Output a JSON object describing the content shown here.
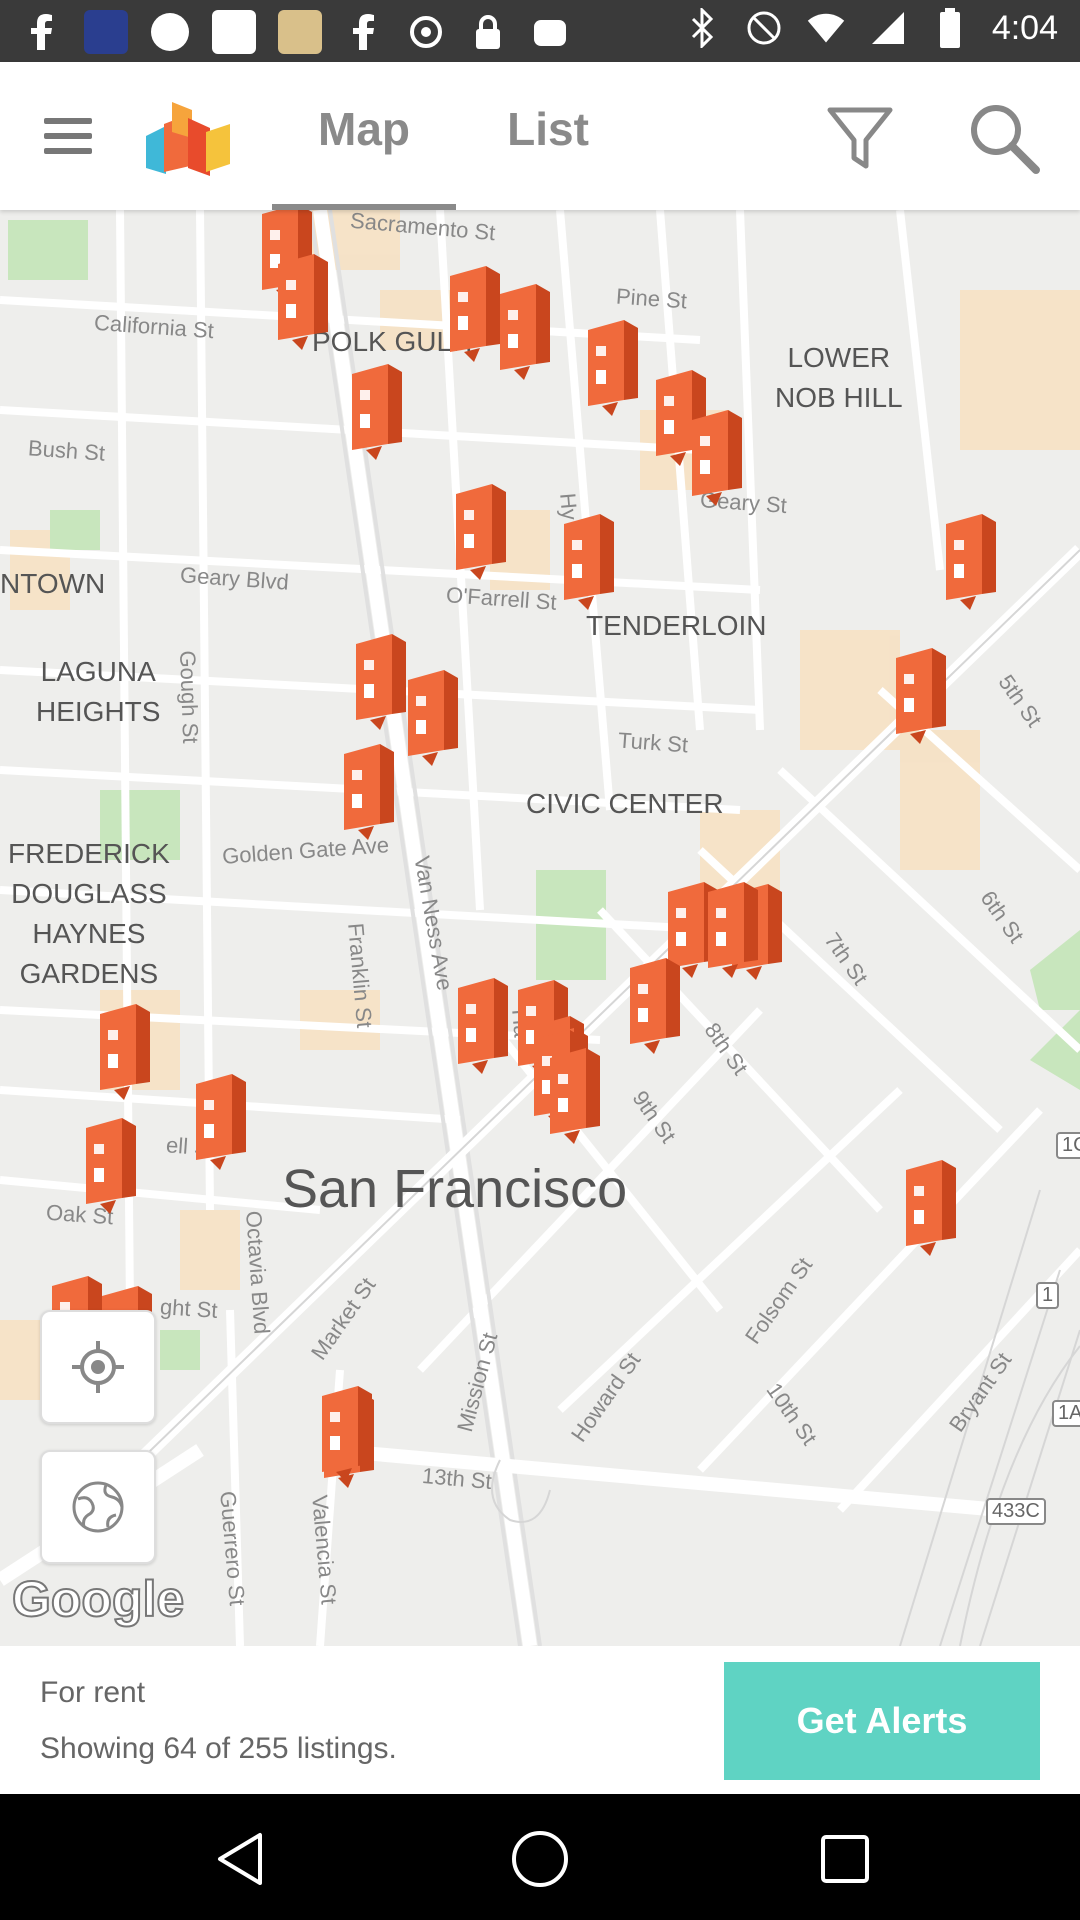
{
  "status_bar": {
    "time": "4:04",
    "left_icons": [
      "facebook-icon",
      "sarah-yasin-app-icon",
      "circle-icon",
      "travel-app-icon",
      "photo-app-icon",
      "facebook-icon",
      "sync-icon",
      "lock-icon",
      "camera-app-icon"
    ],
    "right_icons": [
      "bluetooth-icon",
      "no-sim-icon",
      "wifi-icon",
      "signal-icon",
      "battery-icon"
    ]
  },
  "app_bar": {
    "tabs": [
      {
        "label": "Map",
        "selected": true
      },
      {
        "label": "List",
        "selected": false
      }
    ],
    "menu_icon": "menu-icon",
    "filter_icon": "filter-icon",
    "search_icon": "search-icon"
  },
  "map": {
    "city": "San Francisco",
    "neighborhoods": {
      "polk_gulch": "POLK GUL",
      "polk_gulch_tail": "H",
      "lower_nob_hill": [
        "LOWER",
        "NOB HILL"
      ],
      "tenderloin": "TENDERLOIN",
      "civic_center": "CIVIC CENTER",
      "downtown": "NTOWN",
      "laguna_heights": [
        "LAGUNA",
        "HEIGHTS"
      ],
      "frederick": [
        "FREDERICK",
        "DOUGLASS",
        "HAYNES",
        "GARDENS"
      ]
    },
    "streets": {
      "sacramento": "Sacramento St",
      "california": "California St",
      "pine": "Pine St",
      "bush": "Bush St",
      "geary_st": "Geary St",
      "geary_blvd": "Geary Blvd",
      "ofarrell": "O'Farrell St",
      "gough": "Gough St",
      "turk": "Turk St",
      "golden_gate": "Golden Gate Ave",
      "van_ness": "Van Ness Ave",
      "franklin": "Franklin St",
      "fifth": "5th St",
      "sixth": "6th St",
      "seventh": "7th St",
      "eighth": "8th St",
      "ninth": "9th St",
      "tenth": "10th St",
      "hyde": "Hy",
      "hayes": "Ha",
      "fell": "ell St",
      "oak": "Oak St",
      "haight": "ght St",
      "octavia": "Octavia Blvd",
      "market": "Market St",
      "mission": "Mission St",
      "howard": "Howard St",
      "folsom": "Folsom St",
      "bryant": "Bryant St",
      "thirteenth": "13th St",
      "valencia": "Valencia St",
      "guerrero": "Guerrero St"
    },
    "highway_shields": [
      "1",
      "1A",
      "433C",
      "1C"
    ],
    "listing_pin_count": 33,
    "locate_icon": "my-location-icon",
    "globe_icon": "globe-icon",
    "google_label": "Google"
  },
  "footer": {
    "listing_type": "For rent",
    "count_text": "Showing 64 of 255 listings.",
    "alerts_button": "Get Alerts",
    "alerts_color": "#5fd3c3"
  },
  "nav_bar": {
    "back_icon": "back-icon",
    "home_icon": "home-icon",
    "recents_icon": "recents-icon"
  },
  "colors": {
    "pin": "#f06a3c",
    "pin_dark": "#c9461e",
    "map_bg": "#eeeeec",
    "park": "#c8e6bd",
    "block_tan": "#f6e1c4"
  }
}
